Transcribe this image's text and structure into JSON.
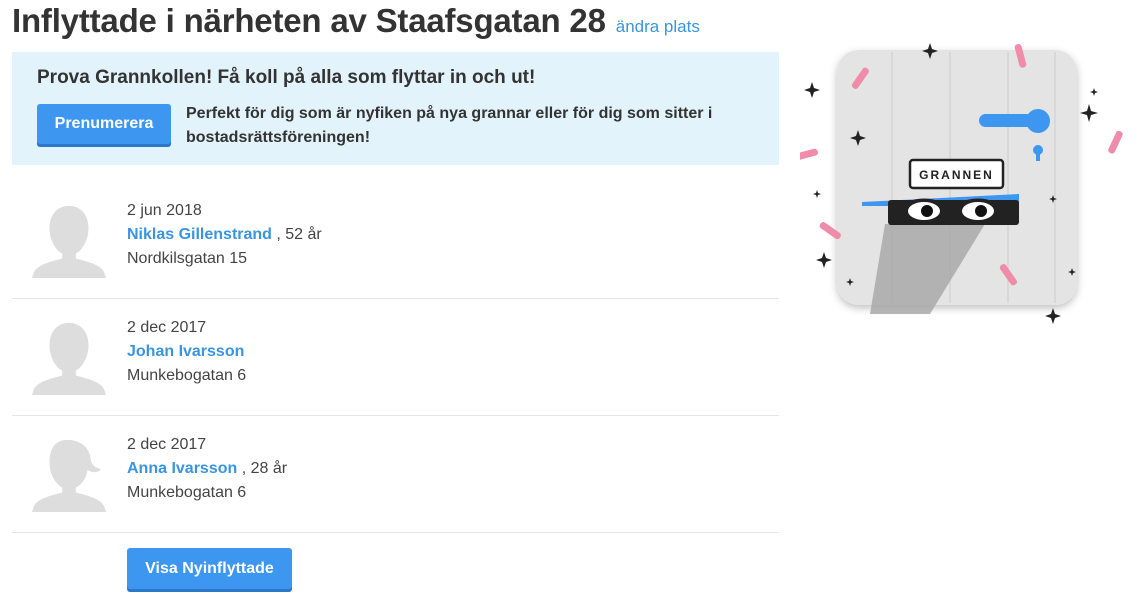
{
  "header": {
    "title": "Inflyttade i närheten av Staafsgatan 28",
    "change_location_label": "ändra plats"
  },
  "promo": {
    "heading": "Prova Grannkollen! Få koll på alla som flyttar in och ut!",
    "subscribe_label": "Prenumerera",
    "description": "Perfekt för dig som är nyfiken på nya grannar eller för dig som sitter i bostadsrättsföreningen!"
  },
  "residents": [
    {
      "date": "2 jun 2018",
      "name": "Niklas Gillenstrand",
      "age_text": ", 52 år",
      "address": "Nordkilsgatan 15",
      "avatar_icon": "male-avatar-icon"
    },
    {
      "date": "2 dec 2017",
      "name": "Johan Ivarsson",
      "age_text": "",
      "address": "Munkebogatan 6",
      "avatar_icon": "male-avatar-icon"
    },
    {
      "date": "2 dec 2017",
      "name": "Anna Ivarsson",
      "age_text": ", 28 år",
      "address": "Munkebogatan 6",
      "avatar_icon": "female-avatar-icon"
    }
  ],
  "more_button_label": "Visa Nyinflyttade",
  "illustration": {
    "sign_text": "GRANNEN"
  },
  "colors": {
    "accent": "#3d96f0",
    "link": "#3a95e0",
    "promo_bg": "#e3f3fb",
    "avatar": "#dddddd",
    "confetti": "#f08cab"
  }
}
